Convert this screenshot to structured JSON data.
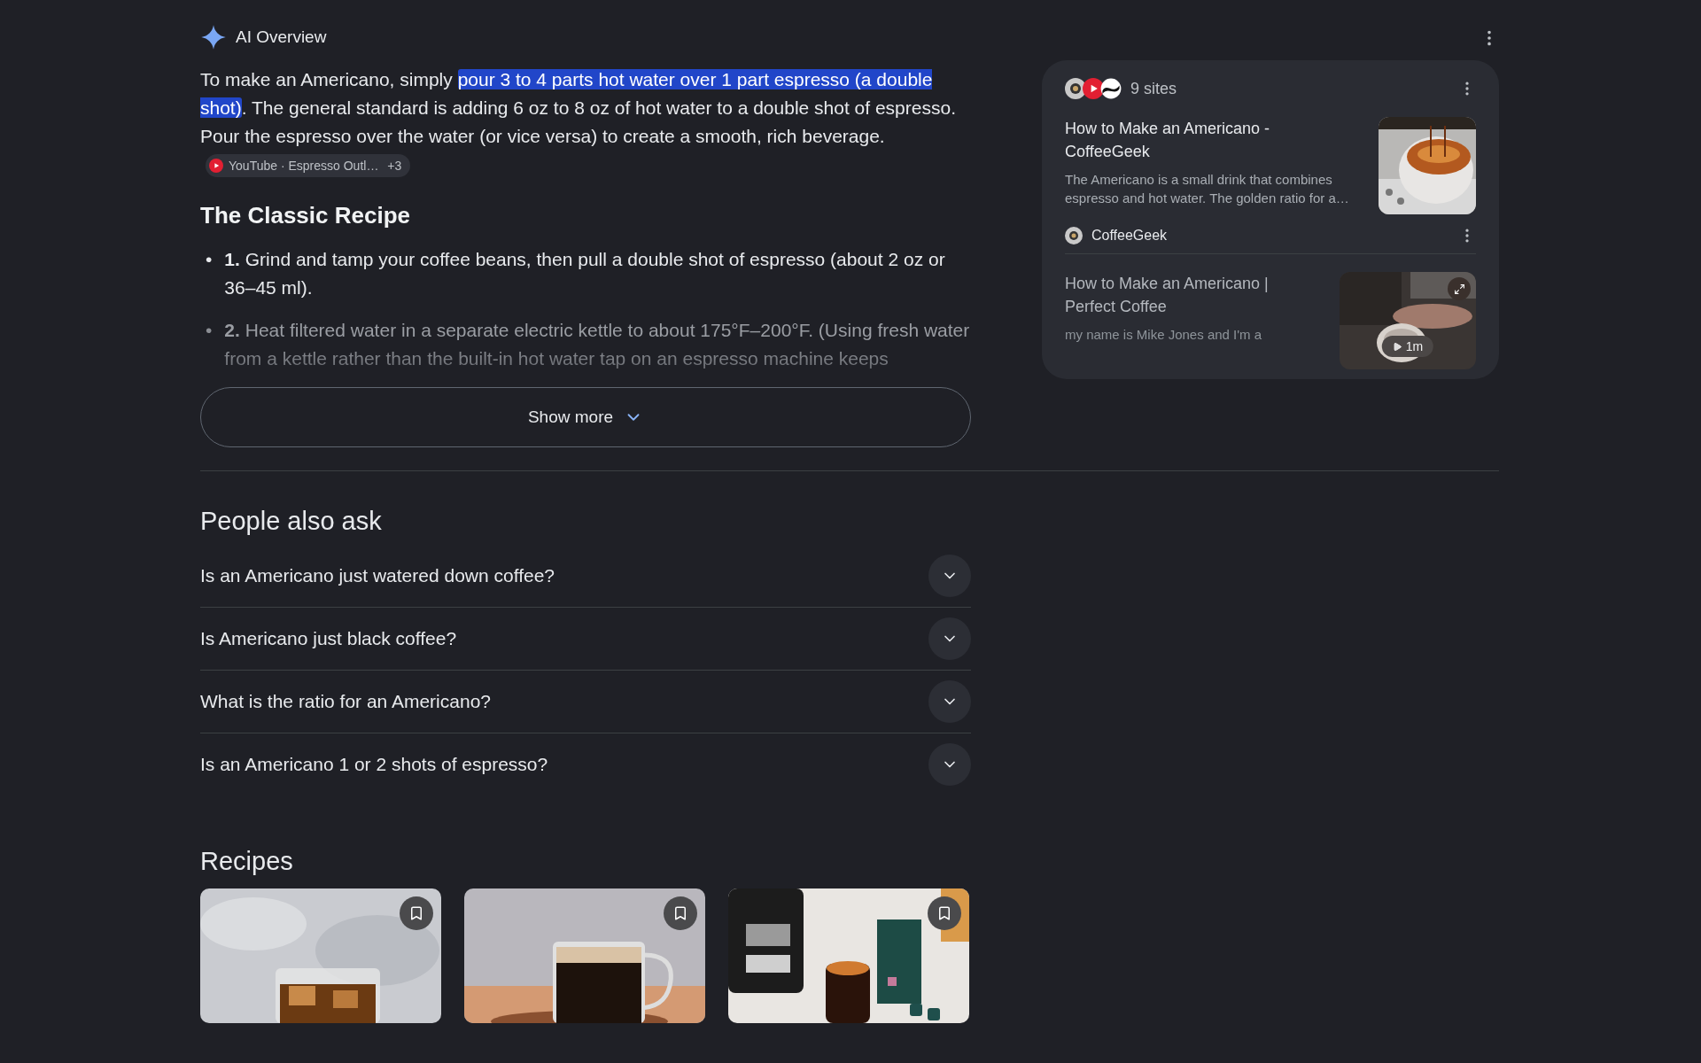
{
  "overview": {
    "title": "AI Overview",
    "intro": [
      {
        "text": "To make an Americano, simply ",
        "highlighted": false
      },
      {
        "text": "pour 3 to 4 parts hot water over 1 part espresso (a double shot)",
        "highlighted": true
      },
      {
        "text": ". The general standard is adding 6 oz to 8 oz of hot water to a double shot of espresso. Pour the espresso over the water (or vice versa) to create a smooth, rich beverage.",
        "highlighted": false
      }
    ],
    "citation": {
      "source": "YouTube · Espresso Outl…",
      "more": "+3"
    },
    "section_title": "The Classic Recipe",
    "steps": [
      {
        "marker": "•",
        "number": "1.",
        "text": "Grind and tamp your coffee beans, then pull a double shot of espresso (about 2 oz or 36–45 ml).",
        "faded": false
      },
      {
        "marker": "•",
        "number": "2.",
        "text": "Heat filtered water in a separate electric kettle to about 175°F–200°F. (Using fresh water from a kettle rather than the built-in hot water tap on an espresso machine keeps",
        "faded": true
      }
    ],
    "show_more": "Show more"
  },
  "sources": {
    "count": "9 sites",
    "items": [
      {
        "title": "How to Make an Americano - CoffeeGeek",
        "snippet": "The Americano is a small drink that combines espresso and hot water. The golden ratio for a…",
        "site": "CoffeeGeek",
        "faded": false
      },
      {
        "title": "How to Make an Americano | Perfect Coffee",
        "snippet": "my name is Mike Jones and I'm a",
        "duration": "1m",
        "faded": true
      }
    ]
  },
  "people_also_ask": {
    "title": "People also ask",
    "questions": [
      {
        "text": "Is an Americano just watered down coffee?",
        "expanded": false
      },
      {
        "text": "Is Americano just black coffee?",
        "expanded": false
      },
      {
        "text": "What is the ratio for an Americano?",
        "expanded": false
      },
      {
        "text": "Is an Americano 1 or 2 shots of espresso?",
        "expanded": false
      }
    ]
  },
  "recipes": {
    "title": "Recipes",
    "cards": [
      {
        "kind": "iced"
      },
      {
        "kind": "mug"
      },
      {
        "kind": "machine"
      }
    ]
  }
}
